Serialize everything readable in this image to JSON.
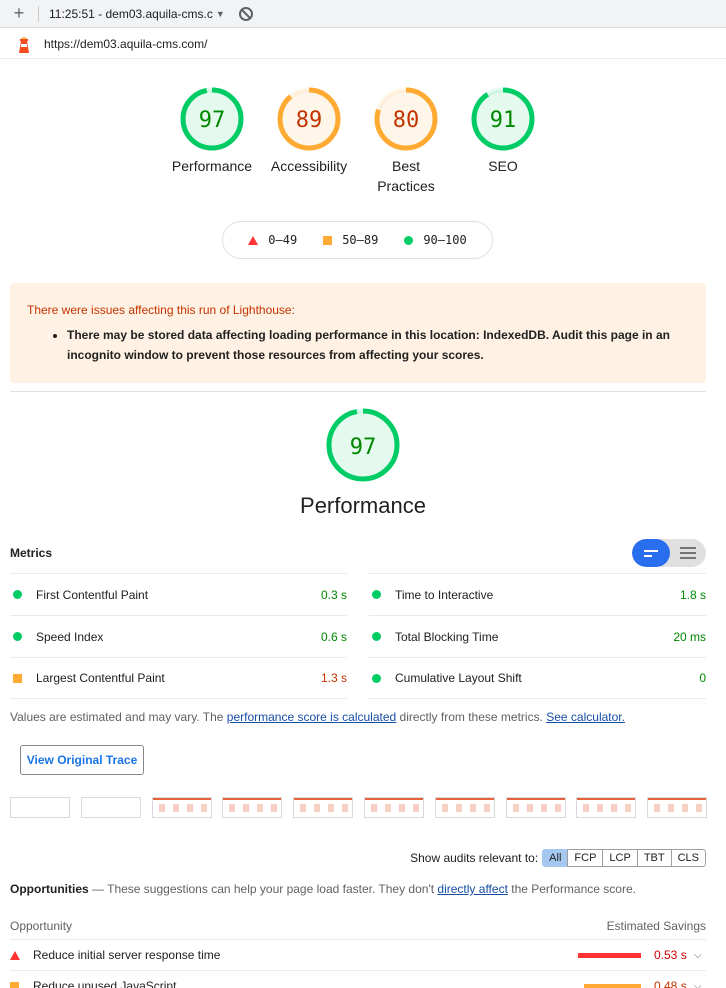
{
  "toolbar": {
    "plus": "+",
    "session": "11:25:51 - dem03.aquila-cms.c",
    "caret": "▼"
  },
  "urlbar": {
    "url": "https://dem03.aquila-cms.com/"
  },
  "colors": {
    "pass": "#0c6",
    "average": "#fa3",
    "fail": "#f33",
    "pass_text": "#080",
    "average_text": "#c33300"
  },
  "gauges": [
    {
      "score": 97,
      "label": "Performance",
      "rating": "pass"
    },
    {
      "score": 89,
      "label": "Accessibility",
      "rating": "average"
    },
    {
      "score": 80,
      "label": "Best Practices",
      "rating": "average"
    },
    {
      "score": 91,
      "label": "SEO",
      "rating": "pass"
    }
  ],
  "legend": {
    "fail": "0–49",
    "average": "50–89",
    "pass": "90–100"
  },
  "warning": {
    "title": "There were issues affecting this run of Lighthouse:",
    "item": "There may be stored data affecting loading performance in this location: IndexedDB. Audit this page in an incognito window to prevent those resources from affecting your scores."
  },
  "performance": {
    "score": 97,
    "title": "Performance"
  },
  "metrics": {
    "title": "Metrics",
    "left": [
      {
        "name": "First Contentful Paint",
        "value": "0.3 s",
        "rating": "pass"
      },
      {
        "name": "Speed Index",
        "value": "0.6 s",
        "rating": "pass"
      },
      {
        "name": "Largest Contentful Paint",
        "value": "1.3 s",
        "rating": "average"
      }
    ],
    "right": [
      {
        "name": "Time to Interactive",
        "value": "1.8 s",
        "rating": "pass"
      },
      {
        "name": "Total Blocking Time",
        "value": "20 ms",
        "rating": "pass"
      },
      {
        "name": "Cumulative Layout Shift",
        "value": "0",
        "rating": "pass"
      }
    ]
  },
  "note": {
    "prefix": "Values are estimated and may vary. The ",
    "link1": "performance score is calculated",
    "middle": " directly from these metrics. ",
    "link2": "See calculator."
  },
  "trace_button": "View Original Trace",
  "filmstrip": {
    "blank_frames": 2,
    "loaded_frames": 8
  },
  "filter": {
    "label": "Show audits relevant to:",
    "chips": [
      "All",
      "FCP",
      "LCP",
      "TBT",
      "CLS"
    ],
    "active": "All"
  },
  "opportunities": {
    "title": "Opportunities",
    "dash": " — ",
    "desc1": "These suggestions can help your page load faster. They don't ",
    "link": "directly affect",
    "desc2": " the Performance score.",
    "col_left": "Opportunity",
    "col_right": "Estimated Savings",
    "items": [
      {
        "name": "Reduce initial server response time",
        "value": "0.53 s",
        "rating": "fail",
        "fraction": 1.0
      },
      {
        "name": "Reduce unused JavaScript",
        "value": "0.48 s",
        "rating": "average",
        "fraction": 0.9
      }
    ]
  }
}
